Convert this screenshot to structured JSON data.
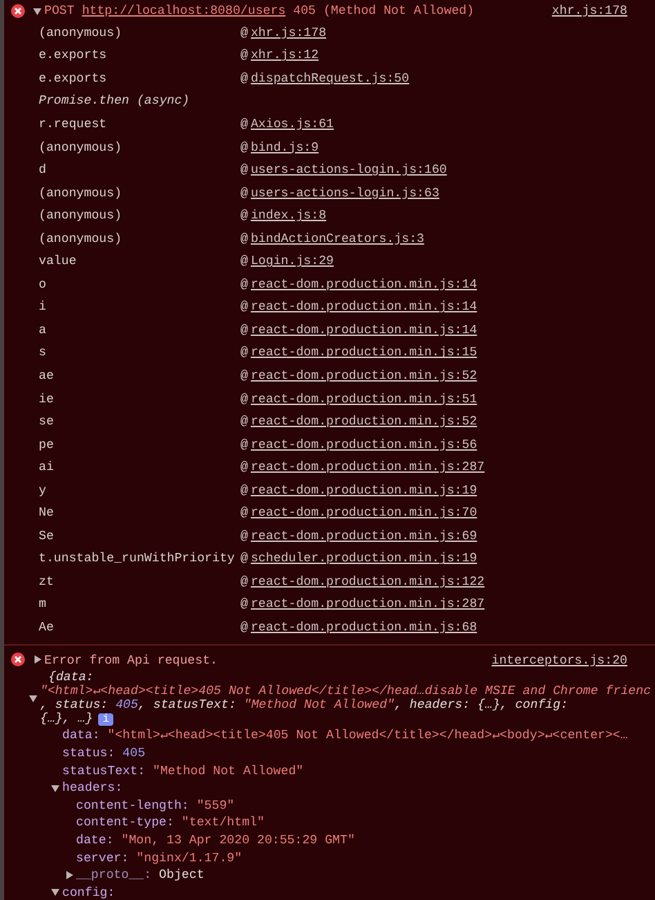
{
  "network_error": {
    "expanded": true,
    "method": "POST",
    "url": "http://localhost:8080/users",
    "status": "405 (Method Not Allowed)",
    "source": "xhr.js:178",
    "frames": [
      {
        "kind": "call",
        "fn": "(anonymous)",
        "at": "@",
        "file": "xhr.js:178"
      },
      {
        "kind": "call",
        "fn": "e.exports",
        "at": "@",
        "file": "xhr.js:12"
      },
      {
        "kind": "call",
        "fn": "e.exports",
        "at": "@",
        "file": "dispatchRequest.js:50"
      },
      {
        "kind": "async",
        "fn": "Promise.then (async)"
      },
      {
        "kind": "call",
        "fn": "r.request",
        "at": "@",
        "file": "Axios.js:61"
      },
      {
        "kind": "call",
        "fn": "(anonymous)",
        "at": "@",
        "file": "bind.js:9"
      },
      {
        "kind": "call",
        "fn": "d",
        "at": "@",
        "file": "users-actions-login.js:160"
      },
      {
        "kind": "call",
        "fn": "(anonymous)",
        "at": "@",
        "file": "users-actions-login.js:63"
      },
      {
        "kind": "call",
        "fn": "(anonymous)",
        "at": "@",
        "file": "index.js:8"
      },
      {
        "kind": "call",
        "fn": "(anonymous)",
        "at": "@",
        "file": "bindActionCreators.js:3"
      },
      {
        "kind": "call",
        "fn": "value",
        "at": "@",
        "file": "Login.js:29"
      },
      {
        "kind": "call",
        "fn": "o",
        "at": "@",
        "file": "react-dom.production.min.js:14"
      },
      {
        "kind": "call",
        "fn": "i",
        "at": "@",
        "file": "react-dom.production.min.js:14"
      },
      {
        "kind": "call",
        "fn": "a",
        "at": "@",
        "file": "react-dom.production.min.js:14"
      },
      {
        "kind": "call",
        "fn": "s",
        "at": "@",
        "file": "react-dom.production.min.js:15"
      },
      {
        "kind": "call",
        "fn": "ae",
        "at": "@",
        "file": "react-dom.production.min.js:52"
      },
      {
        "kind": "call",
        "fn": "ie",
        "at": "@",
        "file": "react-dom.production.min.js:51"
      },
      {
        "kind": "call",
        "fn": "se",
        "at": "@",
        "file": "react-dom.production.min.js:52"
      },
      {
        "kind": "call",
        "fn": "pe",
        "at": "@",
        "file": "react-dom.production.min.js:56"
      },
      {
        "kind": "call",
        "fn": "ai",
        "at": "@",
        "file": "react-dom.production.min.js:287"
      },
      {
        "kind": "call",
        "fn": "y",
        "at": "@",
        "file": "react-dom.production.min.js:19"
      },
      {
        "kind": "call",
        "fn": "Ne",
        "at": "@",
        "file": "react-dom.production.min.js:70"
      },
      {
        "kind": "call",
        "fn": "Se",
        "at": "@",
        "file": "react-dom.production.min.js:69"
      },
      {
        "kind": "call",
        "fn": "t.unstable_runWithPriority",
        "at": "@",
        "file": "scheduler.production.min.js:19"
      },
      {
        "kind": "call",
        "fn": "zt",
        "at": "@",
        "file": "react-dom.production.min.js:122"
      },
      {
        "kind": "call",
        "fn": "m",
        "at": "@",
        "file": "react-dom.production.min.js:287"
      },
      {
        "kind": "call",
        "fn": "Ae",
        "at": "@",
        "file": "react-dom.production.min.js:68"
      }
    ]
  },
  "api_error": {
    "expanded": false,
    "message": "Error from Api request.",
    "source": "interceptors.js:20",
    "object": {
      "expanded": true,
      "info": "i",
      "preview": [
        [
          {
            "kind": "key",
            "text": "{data:"
          }
        ],
        [
          {
            "kind": "string",
            "text": "\"<html>↵<head><title>405 Not Allowed</title></head…disable MSIE and Chrome frienc"
          }
        ],
        [
          {
            "kind": "key",
            "text": ", status: "
          },
          {
            "kind": "number",
            "text": "405"
          },
          {
            "kind": "key",
            "text": ", statusText: "
          },
          {
            "kind": "string",
            "text": "\"Method Not Allowed\""
          },
          {
            "kind": "key",
            "text": ", headers: {…}, config:"
          }
        ],
        [
          {
            "kind": "key",
            "text": "{…}, …}"
          }
        ]
      ],
      "properties": [
        {
          "key": "data:",
          "kind": "string",
          "value": "\"<html>↵<head><title>405 Not Allowed</title></head>↵<body>↵<center><…"
        },
        {
          "key": "status:",
          "kind": "number",
          "value": "405"
        },
        {
          "key": "statusText:",
          "kind": "string",
          "value": "\"Method Not Allowed\""
        },
        {
          "key": "headers:",
          "kind": "object",
          "expanded": true,
          "children": [
            {
              "key": "content-length:",
              "kind": "string",
              "value": "\"559\""
            },
            {
              "key": "content-type:",
              "kind": "string",
              "value": "\"text/html\""
            },
            {
              "key": "date:",
              "kind": "string",
              "value": "\"Mon, 13 Apr 2020 20:55:29 GMT\""
            },
            {
              "key": "server:",
              "kind": "string",
              "value": "\"nginx/1.17.9\""
            },
            {
              "key": "__proto__:",
              "kind": "proto",
              "expanded": false,
              "value": "Object"
            }
          ]
        },
        {
          "key": "config:",
          "kind": "object",
          "expanded": true
        }
      ]
    }
  }
}
